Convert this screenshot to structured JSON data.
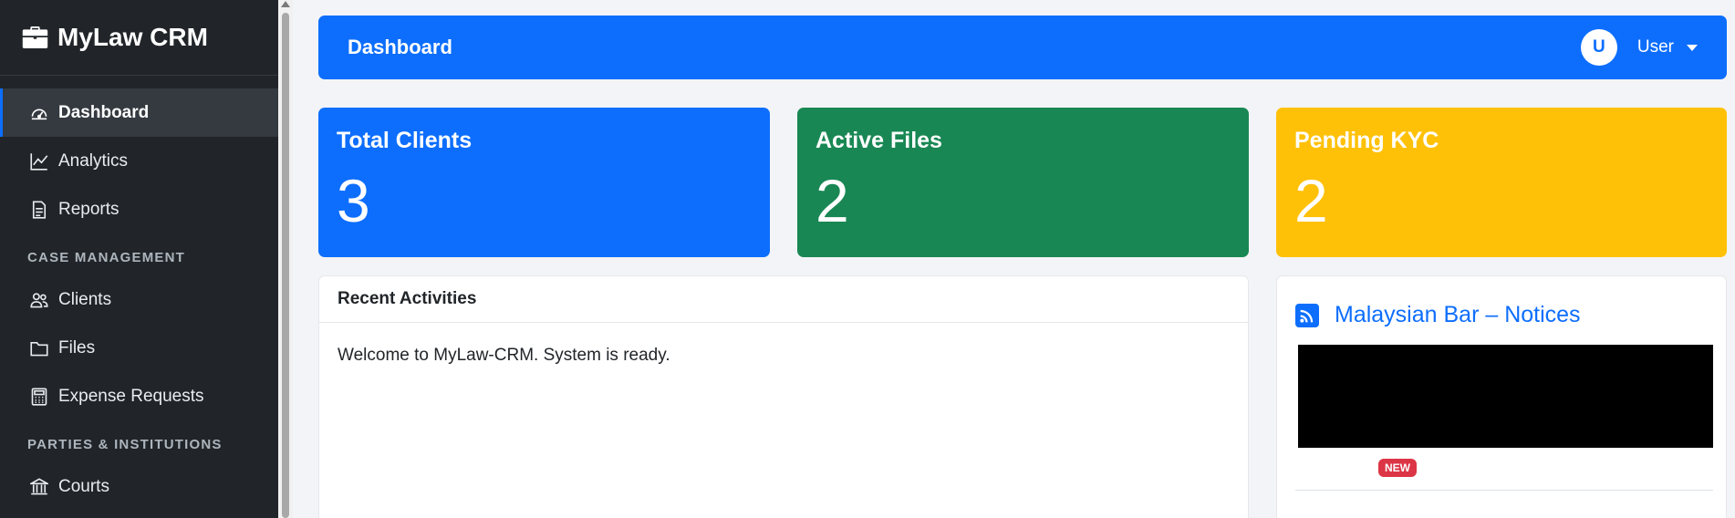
{
  "app": {
    "brand": "MyLaw CRM"
  },
  "sidebar": {
    "items": [
      {
        "label": "Dashboard",
        "icon": "gauge-icon",
        "active": true
      },
      {
        "label": "Analytics",
        "icon": "line-chart-icon"
      },
      {
        "label": "Reports",
        "icon": "document-icon"
      }
    ],
    "section_case": "CASE MANAGEMENT",
    "case_items": [
      {
        "label": "Clients",
        "icon": "people-icon"
      },
      {
        "label": "Files",
        "icon": "folder-icon"
      },
      {
        "label": "Expense Requests",
        "icon": "calculator-icon"
      }
    ],
    "section_parties": "PARTIES & INSTITUTIONS",
    "party_items": [
      {
        "label": "Courts",
        "icon": "bank-icon"
      }
    ]
  },
  "header": {
    "title": "Dashboard",
    "avatar_initial": "U",
    "user_label": "User"
  },
  "stats": [
    {
      "title": "Total Clients",
      "value": "3",
      "color": "#0d6efd"
    },
    {
      "title": "Active Files",
      "value": "2",
      "color": "#198754"
    },
    {
      "title": "Pending KYC",
      "value": "2",
      "color": "#ffc107"
    }
  ],
  "recent": {
    "title": "Recent Activities",
    "message": "Welcome to MyLaw-CRM. System is ready."
  },
  "notices": {
    "title": "Malaysian Bar – Notices",
    "badge": "NEW"
  },
  "colors": {
    "primary": "#0d6efd",
    "success": "#198754",
    "warning": "#ffc107",
    "danger": "#dc3545",
    "sidebar": "#212529"
  }
}
